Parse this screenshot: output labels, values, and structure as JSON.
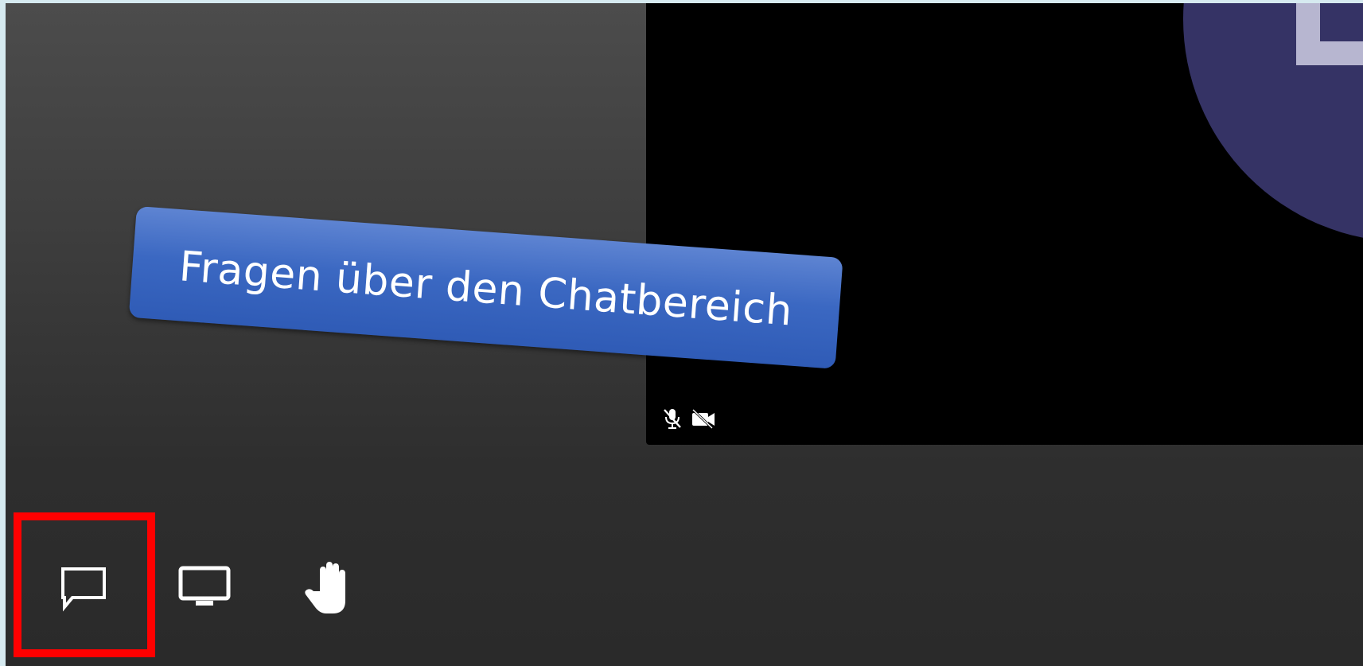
{
  "callout": {
    "text": "Fragen über den Chatbereich"
  },
  "participant_tile": {
    "avatar_color": "#353365",
    "status_icons": [
      "microphone-muted-icon",
      "camera-off-icon"
    ]
  },
  "toolbar": {
    "buttons": [
      {
        "icon": "chat-icon",
        "highlighted": true
      },
      {
        "icon": "screen-share-icon",
        "highlighted": false
      },
      {
        "icon": "raise-hand-icon",
        "highlighted": false
      }
    ],
    "highlight_color": "#ff0000"
  },
  "colors": {
    "callout_bg": "#3b68c2",
    "video_bg": "#000000",
    "frame_border": "#d6eaf0"
  }
}
